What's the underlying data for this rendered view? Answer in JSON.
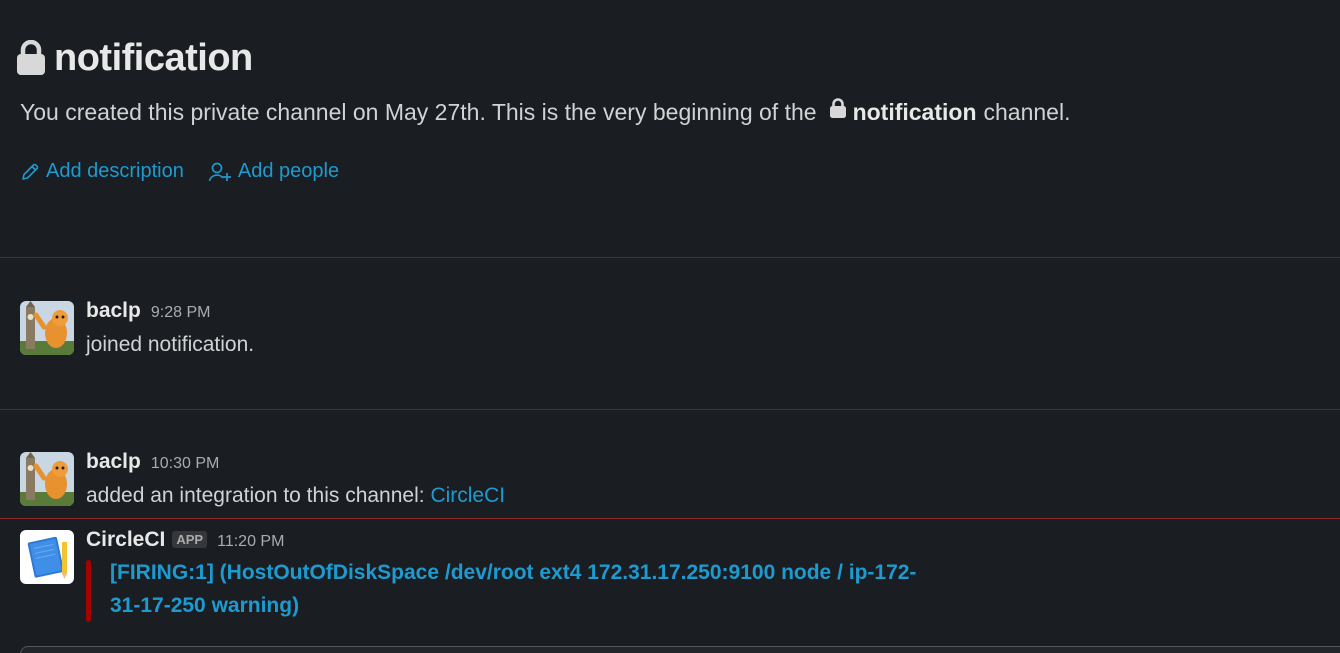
{
  "channel": {
    "name": "notification",
    "intro_prefix": "You created this private channel on May 27th. This is the very beginning of the",
    "intro_suffix": "channel.",
    "actions": {
      "add_description": "Add description",
      "add_people": "Add people"
    }
  },
  "messages": [
    {
      "sender": "baclp",
      "time": "9:28 PM",
      "text": "joined notification."
    },
    {
      "sender": "baclp",
      "time": "10:30 PM",
      "text": "added an integration to this channel:",
      "link": "CircleCI"
    },
    {
      "sender": "CircleCI",
      "badge": "APP",
      "time": "11:20 PM",
      "attachment": {
        "line1": "[FIRING:1]  (HostOutOfDiskSpace /dev/root ext4 172.31.17.250:9100 node / ip-172-",
        "line2": "31-17-250 warning)"
      }
    }
  ],
  "colors": {
    "background": "#1a1d21",
    "link": "#1d9bd1",
    "attachment_bar": "#a30200",
    "new_divider": "#8b2c2c"
  },
  "icons": {
    "lock": "lock-icon",
    "pencil": "pencil-icon",
    "add_person": "add-person-icon"
  }
}
